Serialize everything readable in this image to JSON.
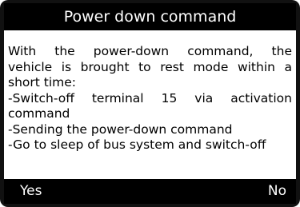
{
  "dialog": {
    "title": "Power down command",
    "lines": [
      "With the power-down command, the",
      "vehicle is brought to rest mode within a",
      "short time:",
      "-Switch-off terminal 15 via activation",
      "command",
      "-Sending the power-down command",
      "-Go to sleep of bus system and switch-off"
    ]
  },
  "buttons": {
    "yes_label": "Yes",
    "no_label": "No"
  },
  "colors": {
    "bezel": "#111111",
    "screen_background": "#ffffff",
    "bar_background": "#000000",
    "bar_text": "#ffffff",
    "body_text": "#000000"
  }
}
